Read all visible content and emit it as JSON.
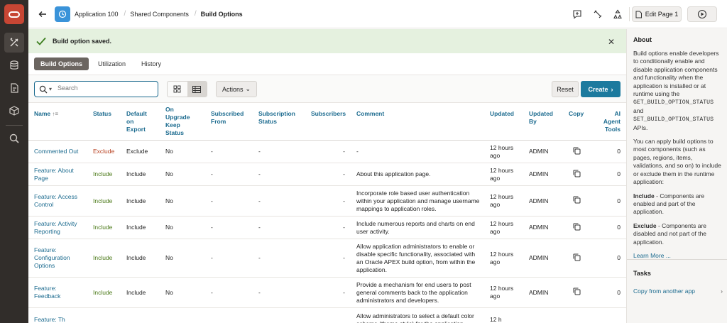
{
  "header": {
    "breadcrumbs": [
      "Application 100",
      "Shared Components",
      "Build Options"
    ],
    "edit_page_label": "Edit Page 1"
  },
  "alert": {
    "message": "Build option saved."
  },
  "tabs": [
    {
      "label": "Build Options",
      "active": true
    },
    {
      "label": "Utilization",
      "active": false
    },
    {
      "label": "History",
      "active": false
    }
  ],
  "toolbar": {
    "search_placeholder": "Search",
    "actions_label": "Actions",
    "reset_label": "Reset",
    "create_label": "Create"
  },
  "table": {
    "columns": [
      {
        "line1": "Name",
        "line2": "",
        "line3": "",
        "line4": ""
      },
      {
        "line1": "Status",
        "line2": "",
        "line3": "",
        "line4": ""
      },
      {
        "line1": "Default",
        "line2": "on",
        "line3": "Export",
        "line4": ""
      },
      {
        "line1": "On",
        "line2": "Upgrade",
        "line3": "Keep",
        "line4": "Status"
      },
      {
        "line1": "Subscribed",
        "line2": "From",
        "line3": "",
        "line4": ""
      },
      {
        "line1": "Subscription",
        "line2": "Status",
        "line3": "",
        "line4": ""
      },
      {
        "line1": "Subscribers",
        "line2": "",
        "line3": "",
        "line4": ""
      },
      {
        "line1": "Comment",
        "line2": "",
        "line3": "",
        "line4": ""
      },
      {
        "line1": "Updated",
        "line2": "",
        "line3": "",
        "line4": ""
      },
      {
        "line1": "Updated",
        "line2": "By",
        "line3": "",
        "line4": ""
      },
      {
        "line1": "Copy",
        "line2": "",
        "line3": "",
        "line4": ""
      },
      {
        "line1": "AI",
        "line2": "Agent",
        "line3": "Tools",
        "line4": ""
      }
    ],
    "rows": [
      {
        "name": "Commented Out",
        "status": "Exclude",
        "default": "Exclude",
        "keep": "No",
        "subfrom": "-",
        "substatus": "-",
        "subscribers": "-",
        "comment": "-",
        "updated": "12 hours ago",
        "by": "ADMIN",
        "ai": "0"
      },
      {
        "name": "Feature: About Page",
        "status": "Include",
        "default": "Include",
        "keep": "No",
        "subfrom": "-",
        "substatus": "-",
        "subscribers": "-",
        "comment": "About this application page.",
        "updated": "12 hours ago",
        "by": "ADMIN",
        "ai": "0"
      },
      {
        "name": "Feature: Access Control",
        "status": "Include",
        "default": "Include",
        "keep": "No",
        "subfrom": "-",
        "substatus": "-",
        "subscribers": "-",
        "comment": "Incorporate role based user authentication within your application and manage username mappings to application roles.",
        "updated": "12 hours ago",
        "by": "ADMIN",
        "ai": "0"
      },
      {
        "name": "Feature: Activity Reporting",
        "status": "Include",
        "default": "Include",
        "keep": "No",
        "subfrom": "-",
        "substatus": "-",
        "subscribers": "-",
        "comment": "Include numerous reports and charts on end user activity.",
        "updated": "12 hours ago",
        "by": "ADMIN",
        "ai": "0"
      },
      {
        "name": "Feature: Configuration Options",
        "status": "Include",
        "default": "Include",
        "keep": "No",
        "subfrom": "-",
        "substatus": "-",
        "subscribers": "-",
        "comment": "Allow application administrators to enable or disable specific functionality, associated with an Oracle APEX build option, from within the application.",
        "updated": "12 hours ago",
        "by": "ADMIN",
        "ai": "0"
      },
      {
        "name": "Feature: Feedback",
        "status": "Include",
        "default": "Include",
        "keep": "No",
        "subfrom": "-",
        "substatus": "-",
        "subscribers": "-",
        "comment": "Provide a mechanism for end users to post general comments back to the application administrators and developers.",
        "updated": "12 hours ago",
        "by": "ADMIN",
        "ai": "0"
      },
      {
        "name": "Feature: Th",
        "status": "",
        "default": "",
        "keep": "",
        "subfrom": "",
        "substatus": "",
        "subscribers": "",
        "comment": "Allow administrators to select a default color scheme (theme style) for the application",
        "updated": "12 h",
        "by": "",
        "ai": ""
      }
    ]
  },
  "side": {
    "about_title": "About",
    "about_p1a": "Build options enable developers to conditionally enable and disable application components and functionality when the application is installed or at runtime using the",
    "about_code1": "GET_BUILD_OPTION_STATUS",
    "about_and": "and",
    "about_code2": "SET_BUILD_OPTION_STATUS",
    "about_p1b": "APIs.",
    "about_p2": "You can apply build options to most components (such as pages, regions, items, validations, and so on) to include or exclude them in the runtime application:",
    "include_label": "Include",
    "include_text": " - Components are enabled and part of the application.",
    "exclude_label": "Exclude",
    "exclude_text": " - Components are disabled and not part of the application.",
    "learn_more": "Learn More ...",
    "tasks_title": "Tasks",
    "task1": "Copy from another app"
  }
}
